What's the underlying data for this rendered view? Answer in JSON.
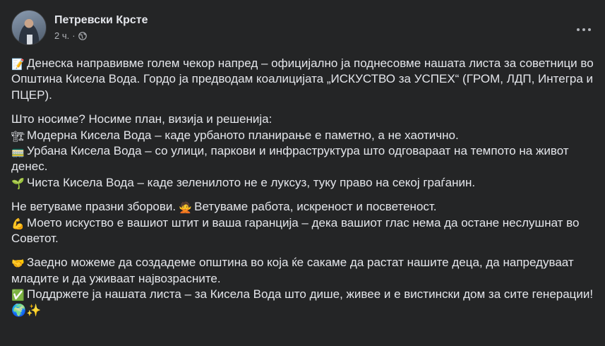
{
  "post": {
    "author": "Петревски Крсте",
    "time": "2 ч.",
    "separator": "·",
    "privacy_icon": "globe-icon",
    "more_icon": "more-options-icon"
  },
  "content": {
    "p1": {
      "emoji": "📝",
      "text": "Денеска направивме голем чекор напред – официјално ја поднесовме нашата листа за советници во Општина Кисела Вода. Гордо ја предводам коалицијата „ИСКУСТВО за УСПЕХ“ (ГРОМ, ЛДП, Интегра и ПЦЕР)."
    },
    "p2": {
      "intro": "Што носиме? Носиме план, визија и решенија:",
      "item1_emoji": "🏗",
      "item1": "Модерна Кисела Вода – каде урбаното планирање е паметно, а не хаотично.",
      "item2_emoji": "🚃",
      "item2": "Урбана Кисела Вода – со улици, паркови и инфраструктура што одговараат на темпото на живот денес.",
      "item3_emoji": "🌱",
      "item3": "Чиста Кисела Вода – каде зеленилото не е луксуз, туку право на секој граѓанин."
    },
    "p3": {
      "line1a": "Не ветуваме празни зборови.",
      "line1_emoji": "🙅",
      "line1b": "Ветуваме работа, искреност и посветеност.",
      "line2_emoji": "💪",
      "line2": "Моето искуство е вашиот штит и ваша гаранција – дека вашиот глас нема да остане неслушнат во Советот."
    },
    "p4": {
      "line1_emoji": "🤝",
      "line1": "Заедно можеме да создадеме општина во која ќе сакаме да растат нашите деца, да напредуваат младите и да уживаат највозрасните.",
      "line2_emoji": "✅",
      "line2": "Поддржете ја нашата листа – за Кисела Вода што дише, живее и е вистински дом за сите генерации!",
      "end_emoji": "🌍✨"
    }
  }
}
